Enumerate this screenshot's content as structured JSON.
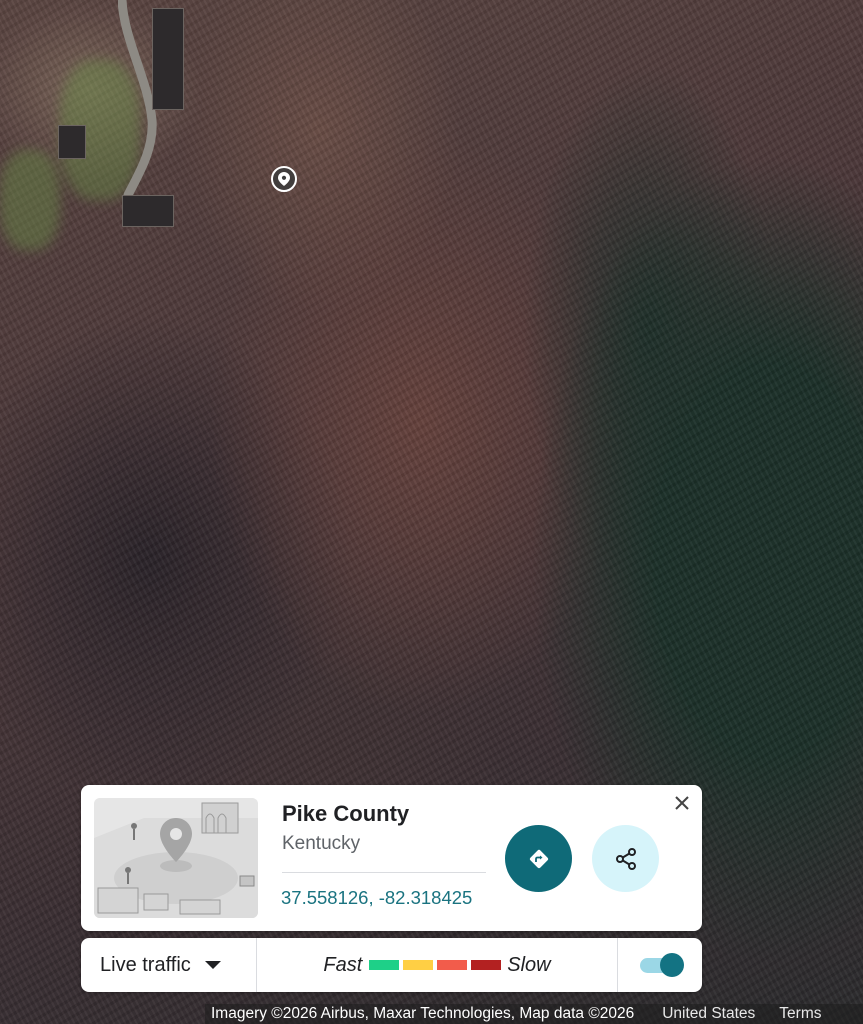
{
  "map": {
    "type": "satellite",
    "marker_icon": "location-pin-icon"
  },
  "place_card": {
    "title": "Pike County",
    "subtitle": "Kentucky",
    "coordinates": "37.558126, -82.318425",
    "thumbnail_icon": "street-view-illustration",
    "directions_icon": "directions-icon",
    "share_icon": "share-icon",
    "close_icon": "close-icon",
    "accent_color": "#0f6a78"
  },
  "traffic_bar": {
    "label": "Live traffic",
    "legend_fast": "Fast",
    "legend_slow": "Slow",
    "legend_colors": [
      "#1ed088",
      "#ffcf44",
      "#f25c4b",
      "#b32121"
    ],
    "toggle_on": true
  },
  "attribution": {
    "credit": "Imagery ©2026 Airbus, Maxar Technologies, Map data ©2026",
    "country": "United States",
    "terms": "Terms"
  }
}
